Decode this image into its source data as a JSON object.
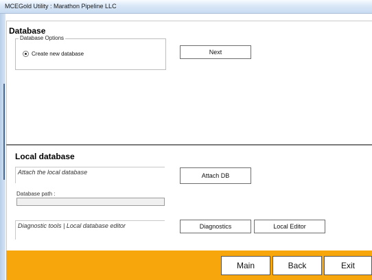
{
  "window": {
    "title": "MCEGold Utility : Marathon Pipeline LLC"
  },
  "database": {
    "title": "Database",
    "options_legend": "Database Options",
    "option_create": "Create new database",
    "next_label": "Next"
  },
  "local": {
    "title": "Local database",
    "attach_text": "Attach the local database",
    "attach_label": "Attach DB",
    "path_label": "Database path :",
    "path_value": "",
    "diag_text": "Diagnostic tools  |  Local database editor",
    "diagnostics_label": "Diagnostics",
    "local_editor_label": "Local Editor"
  },
  "footer": {
    "main_label": "Main",
    "back_label": "Back",
    "exit_label": "Exit"
  },
  "colors": {
    "footer": "#f7a60c",
    "titlebar": "#c9dcf2"
  }
}
